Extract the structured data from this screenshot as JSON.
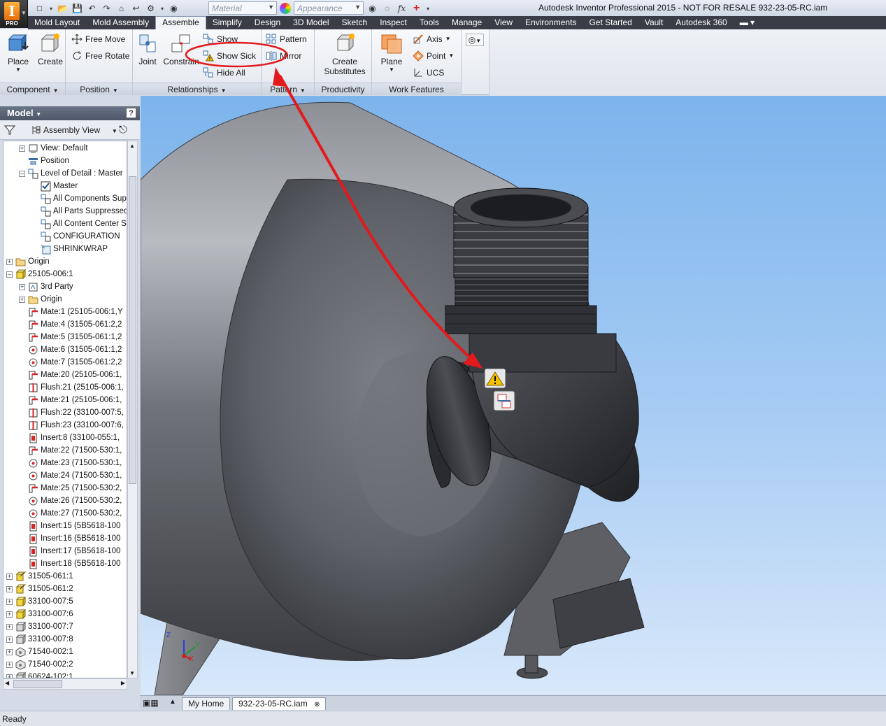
{
  "app": {
    "logo_letter": "I",
    "edition": "PRO",
    "title": "Autodesk Inventor Professional 2015 - NOT FOR RESALE   932-23-05-RC.iam"
  },
  "qat": {
    "material_placeholder": "Material",
    "appearance_placeholder": "Appearance",
    "fx_label": "fx"
  },
  "tabs": [
    "Mold Layout",
    "Mold Assembly",
    "Assemble",
    "Simplify",
    "Design",
    "3D Model",
    "Sketch",
    "Inspect",
    "Tools",
    "Manage",
    "View",
    "Environments",
    "Get Started",
    "Vault",
    "Autodesk 360"
  ],
  "active_tab": "Assemble",
  "ribbon": {
    "component": {
      "label": "Component",
      "place": "Place",
      "create": "Create"
    },
    "position": {
      "label": "Position",
      "free_move": "Free Move",
      "free_rotate": "Free Rotate"
    },
    "relationships": {
      "label": "Relationships",
      "joint": "Joint",
      "constrain": "Constrain",
      "show": "Show",
      "show_sick": "Show Sick",
      "hide_all": "Hide All"
    },
    "pattern": {
      "label": "Pattern",
      "pattern": "Pattern",
      "mirror": "Mirror"
    },
    "productivity": {
      "label": "Productivity",
      "create_substitutes_1": "Create",
      "create_substitutes_2": "Substitutes"
    },
    "work_features": {
      "label": "Work Features",
      "plane": "Plane",
      "axis": "Axis",
      "point": "Point",
      "ucs": "UCS"
    }
  },
  "browser": {
    "title": "Model",
    "help": "?",
    "view": "Assembly View",
    "nodes": [
      {
        "label": "View: Default",
        "indent": 1,
        "exp": "+",
        "icon": "view"
      },
      {
        "label": "Position",
        "indent": 1,
        "exp": "",
        "icon": "position"
      },
      {
        "label": "Level of Detail : Master",
        "indent": 1,
        "exp": "-",
        "icon": "lod"
      },
      {
        "label": "Master",
        "indent": 2,
        "exp": "",
        "icon": "lod-check"
      },
      {
        "label": "All Components Suppressed",
        "indent": 2,
        "exp": "",
        "icon": "lod"
      },
      {
        "label": "All Parts Suppressed",
        "indent": 2,
        "exp": "",
        "icon": "lod"
      },
      {
        "label": "All Content Center Suppressed",
        "indent": 2,
        "exp": "",
        "icon": "lod"
      },
      {
        "label": "CONFIGURATION",
        "indent": 2,
        "exp": "",
        "icon": "lod"
      },
      {
        "label": "SHRINKWRAP",
        "indent": 2,
        "exp": "",
        "icon": "shrink"
      },
      {
        "label": "Origin",
        "indent": 0,
        "exp": "+",
        "icon": "folder"
      },
      {
        "label": "25105-006:1",
        "indent": 0,
        "exp": "-",
        "icon": "assy"
      },
      {
        "label": "3rd Party",
        "indent": 1,
        "exp": "+",
        "icon": "party"
      },
      {
        "label": "Origin",
        "indent": 1,
        "exp": "+",
        "icon": "folder"
      },
      {
        "label": "Mate:1 (25105-006:1,Y",
        "indent": 1,
        "exp": "",
        "icon": "mate"
      },
      {
        "label": "Mate:4 (31505-061:2,2",
        "indent": 1,
        "exp": "",
        "icon": "mate"
      },
      {
        "label": "Mate:5 (31505-061:1,2",
        "indent": 1,
        "exp": "",
        "icon": "mate"
      },
      {
        "label": "Mate:6 (31505-061:1,2",
        "indent": 1,
        "exp": "",
        "icon": "mate-circ"
      },
      {
        "label": "Mate:7 (31505-061:2,2",
        "indent": 1,
        "exp": "",
        "icon": "mate-circ"
      },
      {
        "label": "Mate:20 (25105-006:1,",
        "indent": 1,
        "exp": "",
        "icon": "mate"
      },
      {
        "label": "Flush:21 (25105-006:1,",
        "indent": 1,
        "exp": "",
        "icon": "flush"
      },
      {
        "label": "Mate:21 (25105-006:1,",
        "indent": 1,
        "exp": "",
        "icon": "mate"
      },
      {
        "label": "Flush:22 (33100-007:5,",
        "indent": 1,
        "exp": "",
        "icon": "flush"
      },
      {
        "label": "Flush:23 (33100-007:6,",
        "indent": 1,
        "exp": "",
        "icon": "flush"
      },
      {
        "label": "Insert:8 (33100-055:1,",
        "indent": 1,
        "exp": "",
        "icon": "insert"
      },
      {
        "label": "Mate:22 (71500-530:1,",
        "indent": 1,
        "exp": "",
        "icon": "mate"
      },
      {
        "label": "Mate:23 (71500-530:1,",
        "indent": 1,
        "exp": "",
        "icon": "mate-circ"
      },
      {
        "label": "Mate:24 (71500-530:1,",
        "indent": 1,
        "exp": "",
        "icon": "mate-circ"
      },
      {
        "label": "Mate:25 (71500-530:2,",
        "indent": 1,
        "exp": "",
        "icon": "mate"
      },
      {
        "label": "Mate:26 (71500-530:2,",
        "indent": 1,
        "exp": "",
        "icon": "mate-circ"
      },
      {
        "label": "Mate:27 (71500-530:2,",
        "indent": 1,
        "exp": "",
        "icon": "mate-circ"
      },
      {
        "label": "Insert:15 (5B5618-100",
        "indent": 1,
        "exp": "",
        "icon": "insert"
      },
      {
        "label": "Insert:16 (5B5618-100",
        "indent": 1,
        "exp": "",
        "icon": "insert"
      },
      {
        "label": "Insert:17 (5B5618-100",
        "indent": 1,
        "exp": "",
        "icon": "insert"
      },
      {
        "label": "Insert:18 (5B5618-100",
        "indent": 1,
        "exp": "",
        "icon": "insert"
      },
      {
        "label": "31505-061:1",
        "indent": 0,
        "exp": "+",
        "icon": "assy-out"
      },
      {
        "label": "31505-061:2",
        "indent": 0,
        "exp": "+",
        "icon": "assy-out"
      },
      {
        "label": "33100-007:5",
        "indent": 0,
        "exp": "+",
        "icon": "assy"
      },
      {
        "label": "33100-007:6",
        "indent": 0,
        "exp": "+",
        "icon": "assy"
      },
      {
        "label": "33100-007:7",
        "indent": 0,
        "exp": "+",
        "icon": "part"
      },
      {
        "label": "33100-007:8",
        "indent": 0,
        "exp": "+",
        "icon": "part"
      },
      {
        "label": "71540-002:1",
        "indent": 0,
        "exp": "+",
        "icon": "part-cc"
      },
      {
        "label": "71540-002:2",
        "indent": 0,
        "exp": "+",
        "icon": "part-cc"
      },
      {
        "label": "60624-102:1",
        "indent": 0,
        "exp": "+",
        "icon": "part"
      }
    ]
  },
  "doc_tabs": {
    "home": "My Home",
    "document": "932-23-05-RC.iam",
    "close": "⊗"
  },
  "status": "Ready",
  "triad": {
    "x": "X",
    "y": "Y",
    "z": "Z"
  },
  "colors": {
    "annotation_red": "#e3191c",
    "viewport_sky": "#7cb4ec",
    "sick_yellow": "#f2c200"
  }
}
